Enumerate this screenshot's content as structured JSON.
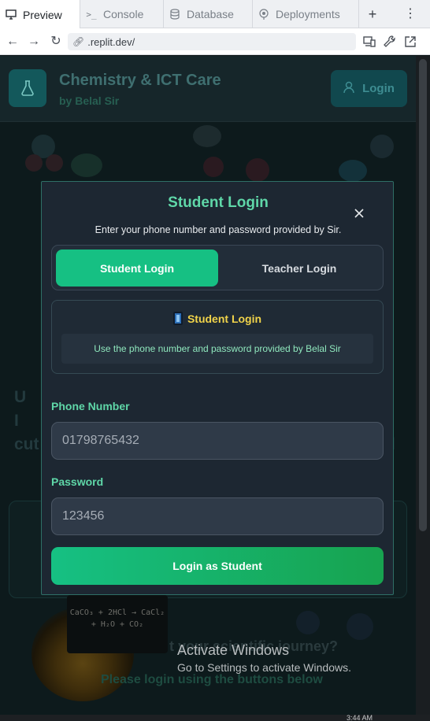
{
  "browser": {
    "tabs": [
      {
        "label": "Preview",
        "icon": "monitor-icon",
        "active": true
      },
      {
        "label": "Console",
        "icon": "terminal-icon",
        "active": false
      },
      {
        "label": "Database",
        "icon": "database-icon",
        "active": false
      },
      {
        "label": "Deployments",
        "icon": "deploy-icon",
        "active": false
      }
    ],
    "new_tab": "+",
    "more": "⋮",
    "url": ".replit.dev/"
  },
  "app": {
    "title": "Chemistry & ICT Care",
    "subtitle": "by Belal Sir",
    "header_login": "Login",
    "formula": "CaCO₃ + 2HCl → CaCl₂ + H₂O + CO₂",
    "journey_fragment": "t your scientific journey?",
    "please_login": "Please login using the buttons below"
  },
  "modal": {
    "title": "Student Login",
    "description": "Enter your phone number and password provided by Sir.",
    "roles": {
      "student": "Student Login",
      "teacher": "Teacher Login"
    },
    "info": {
      "heading": "Student Login",
      "text": "Use the phone number and password provided by Belal Sir"
    },
    "phone": {
      "label": "Phone Number",
      "value": "01798765432"
    },
    "password": {
      "label": "Password",
      "value": "123456"
    },
    "submit": "Login as Student"
  },
  "watermark": {
    "title": "Activate Windows",
    "subtitle": "Go to Settings to activate Windows."
  },
  "taskbar": {
    "time": "3:44 AM"
  },
  "colors": {
    "accent": "#16c083",
    "heading": "#5fd7a8",
    "info": "#f0d34a",
    "modal_bg": "#1d2732"
  }
}
